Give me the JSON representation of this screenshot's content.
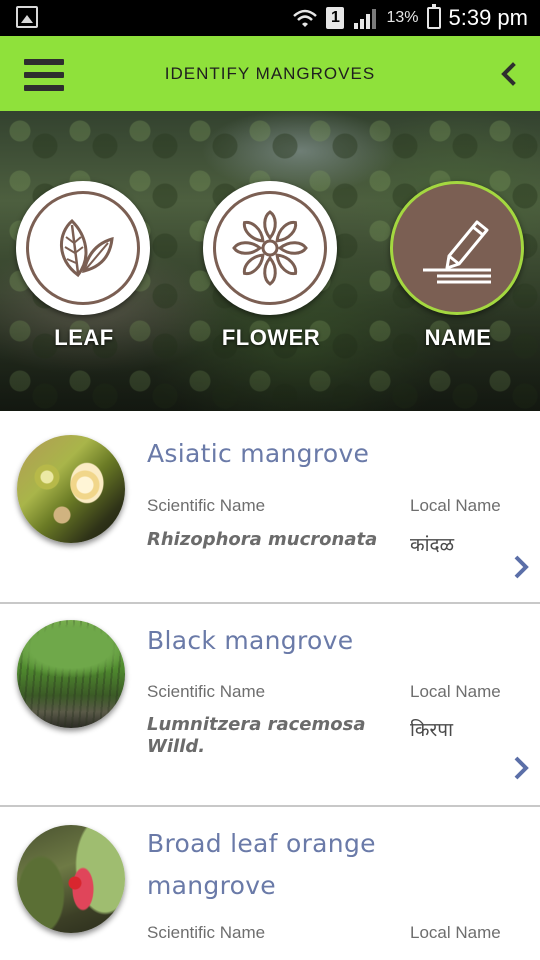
{
  "status_bar": {
    "battery_percent": "13%",
    "time": "5:39 pm",
    "sim_slot": "1"
  },
  "app_bar": {
    "title": "IDENTIFY MANGROVES",
    "menu_icon": "hamburger-menu-icon",
    "back_icon": "chevron-left-icon"
  },
  "modes": [
    {
      "label": "LEAF",
      "icon": "leaf-icon",
      "active": false
    },
    {
      "label": "FLOWER",
      "icon": "flower-icon",
      "active": false
    },
    {
      "label": "NAME",
      "icon": "pen-writing-icon",
      "active": true
    }
  ],
  "labels": {
    "scientific": "Scientific Name",
    "local": "Local Name"
  },
  "species": [
    {
      "common_name": "Asiatic mangrove",
      "scientific_name": "Rhizophora mucronata",
      "local_name": "कांदळ"
    },
    {
      "common_name": "Black mangrove",
      "scientific_name": "Lumnitzera racemosa Willd.",
      "local_name": "किरपा"
    },
    {
      "common_name": "Broad leaf orange mangrove",
      "scientific_name": "",
      "local_name": ""
    }
  ],
  "colors": {
    "app_bar": "#8fe13b",
    "accent_brown": "#7b5f53",
    "active_ring": "#a4d840",
    "common_name": "#6a7aa8",
    "chevron": "#5b6fa8"
  }
}
